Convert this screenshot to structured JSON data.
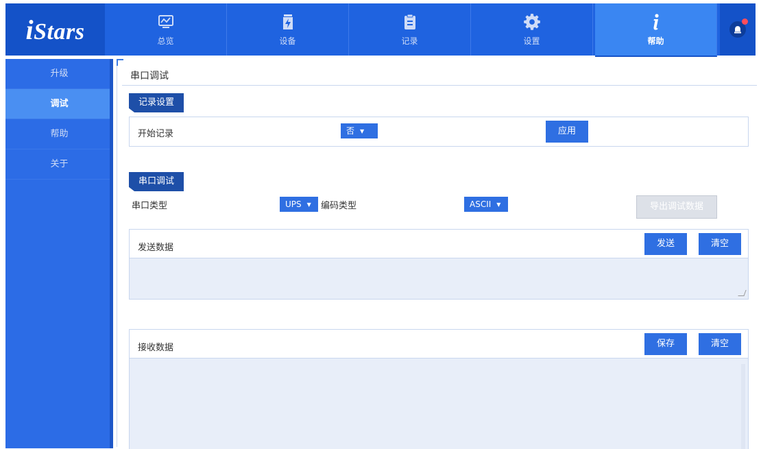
{
  "brand": {
    "logo_i": "i",
    "logo_rest": "Stars"
  },
  "nav": {
    "tabs": [
      {
        "label": "总览",
        "icon": "monitor-chart-icon"
      },
      {
        "label": "设备",
        "icon": "battery-bolt-icon"
      },
      {
        "label": "记录",
        "icon": "clipboard-icon"
      },
      {
        "label": "设置",
        "icon": "gear-icon"
      },
      {
        "label": "帮助",
        "icon": "info-icon",
        "active": true
      }
    ]
  },
  "sidebar": {
    "items": [
      {
        "label": "升级"
      },
      {
        "label": "调试",
        "active": true
      },
      {
        "label": "帮助"
      },
      {
        "label": "关于"
      }
    ]
  },
  "page": {
    "title": "串口调试"
  },
  "record_settings": {
    "tag": "记录设置",
    "start_label": "开始记录",
    "start_value": "否",
    "apply_label": "应用"
  },
  "serial_debug": {
    "tag": "串口调试",
    "port_type_label": "串口类型",
    "port_type_value": "UPS",
    "encoding_label": "编码类型",
    "encoding_value": "ASCII",
    "export_label": "导出调试数据"
  },
  "send": {
    "title": "发送数据",
    "send_label": "发送",
    "clear_label": "清空"
  },
  "receive": {
    "title": "接收数据",
    "save_label": "保存",
    "clear_label": "清空"
  },
  "colors": {
    "nav_bg": "#1f63e0",
    "nav_active": "#3a86f2",
    "sidebar_bg": "#2c6ce6",
    "button": "#2f6fe2",
    "tag_bg": "#1e4fa8",
    "textarea_bg": "#e8eef9"
  }
}
